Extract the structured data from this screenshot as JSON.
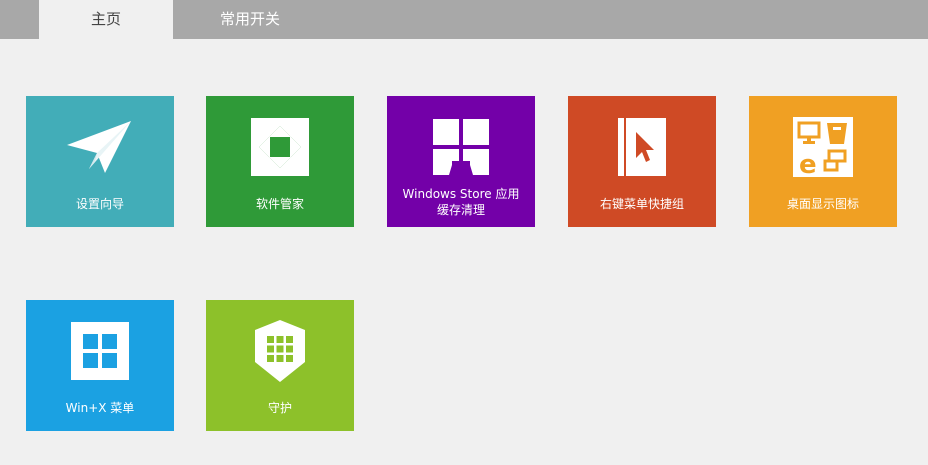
{
  "tabs": [
    {
      "label": "主页",
      "active": true
    },
    {
      "label": "常用开关",
      "active": false
    }
  ],
  "tiles": [
    {
      "label": "设置向导",
      "icon": "paper-plane-icon",
      "color": "#42adb8"
    },
    {
      "label": "软件管家",
      "icon": "aperture-icon",
      "color": "#2f9a38"
    },
    {
      "label_line1": "Windows Store 应用",
      "label_line2": "缓存清理",
      "icon": "store-broom-icon",
      "color": "#7300a8"
    },
    {
      "label": "右键菜单快捷组",
      "icon": "book-cursor-icon",
      "color": "#cf4a25"
    },
    {
      "label": "桌面显示图标",
      "icon": "desktop-icons-icon",
      "color": "#f0a023"
    },
    {
      "label": "Win+X 菜单",
      "icon": "windows-logo-icon",
      "color": "#1ba1e2"
    },
    {
      "label": "守护",
      "icon": "shield-icon",
      "color": "#8dc12a"
    }
  ]
}
